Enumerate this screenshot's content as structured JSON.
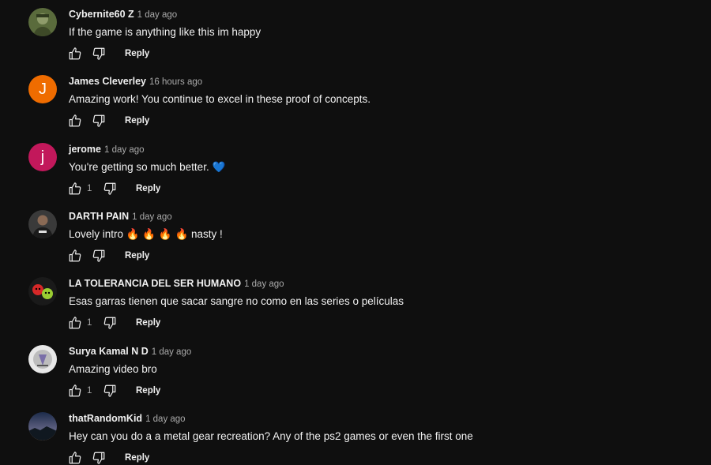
{
  "reply_label": "Reply",
  "comments": [
    {
      "author": "Cybernite60 Z",
      "time": "1 day ago",
      "text": "If the game is anything like this im happy",
      "likes": "",
      "avatar": {
        "type": "image",
        "icon": "soldier-avatar-icon",
        "colors": [
          "#5a6b3c",
          "#8f9c6b"
        ]
      }
    },
    {
      "author": "James Cleverley",
      "time": "16 hours ago",
      "text": "Amazing work! You continue to excel in these proof of concepts.",
      "likes": "",
      "avatar": {
        "type": "letter",
        "letter": "J",
        "color": "#ef6c00"
      }
    },
    {
      "author": "jerome",
      "time": "1 day ago",
      "text": "You're getting so much better. 💙",
      "likes": "1",
      "avatar": {
        "type": "letter",
        "letter": "j",
        "color": "#c2185b"
      }
    },
    {
      "author": "DARTH PAIN",
      "time": "1 day ago",
      "text": "Lovely intro 🔥 🔥 🔥 🔥 nasty !",
      "likes": "",
      "avatar": {
        "type": "image",
        "icon": "person-photo-avatar-icon",
        "colors": [
          "#3a3a3a",
          "#8a6a55"
        ]
      }
    },
    {
      "author": "LA TOLERANCIA DEL SER HUMANO",
      "time": "1 day ago",
      "text": "Esas garras tienen que sacar sangre no como en las series o películas",
      "likes": "1",
      "avatar": {
        "type": "image",
        "icon": "masks-avatar-icon",
        "colors": [
          "#1a1a1a",
          "#d62828"
        ]
      }
    },
    {
      "author": "Surya Kamal N D",
      "time": "1 day ago",
      "text": "Amazing video bro",
      "likes": "1",
      "avatar": {
        "type": "image",
        "icon": "logo-avatar-icon",
        "colors": [
          "#e8e8e8",
          "#7a6fa8"
        ]
      }
    },
    {
      "author": "thatRandomKid",
      "time": "1 day ago",
      "text": "Hey can you do a a metal gear recreation? Any of the ps2 games or even the first one",
      "likes": "",
      "avatar": {
        "type": "image",
        "icon": "sunset-landscape-avatar-icon",
        "colors": [
          "#1c2b4a",
          "#e0a060"
        ]
      }
    }
  ]
}
